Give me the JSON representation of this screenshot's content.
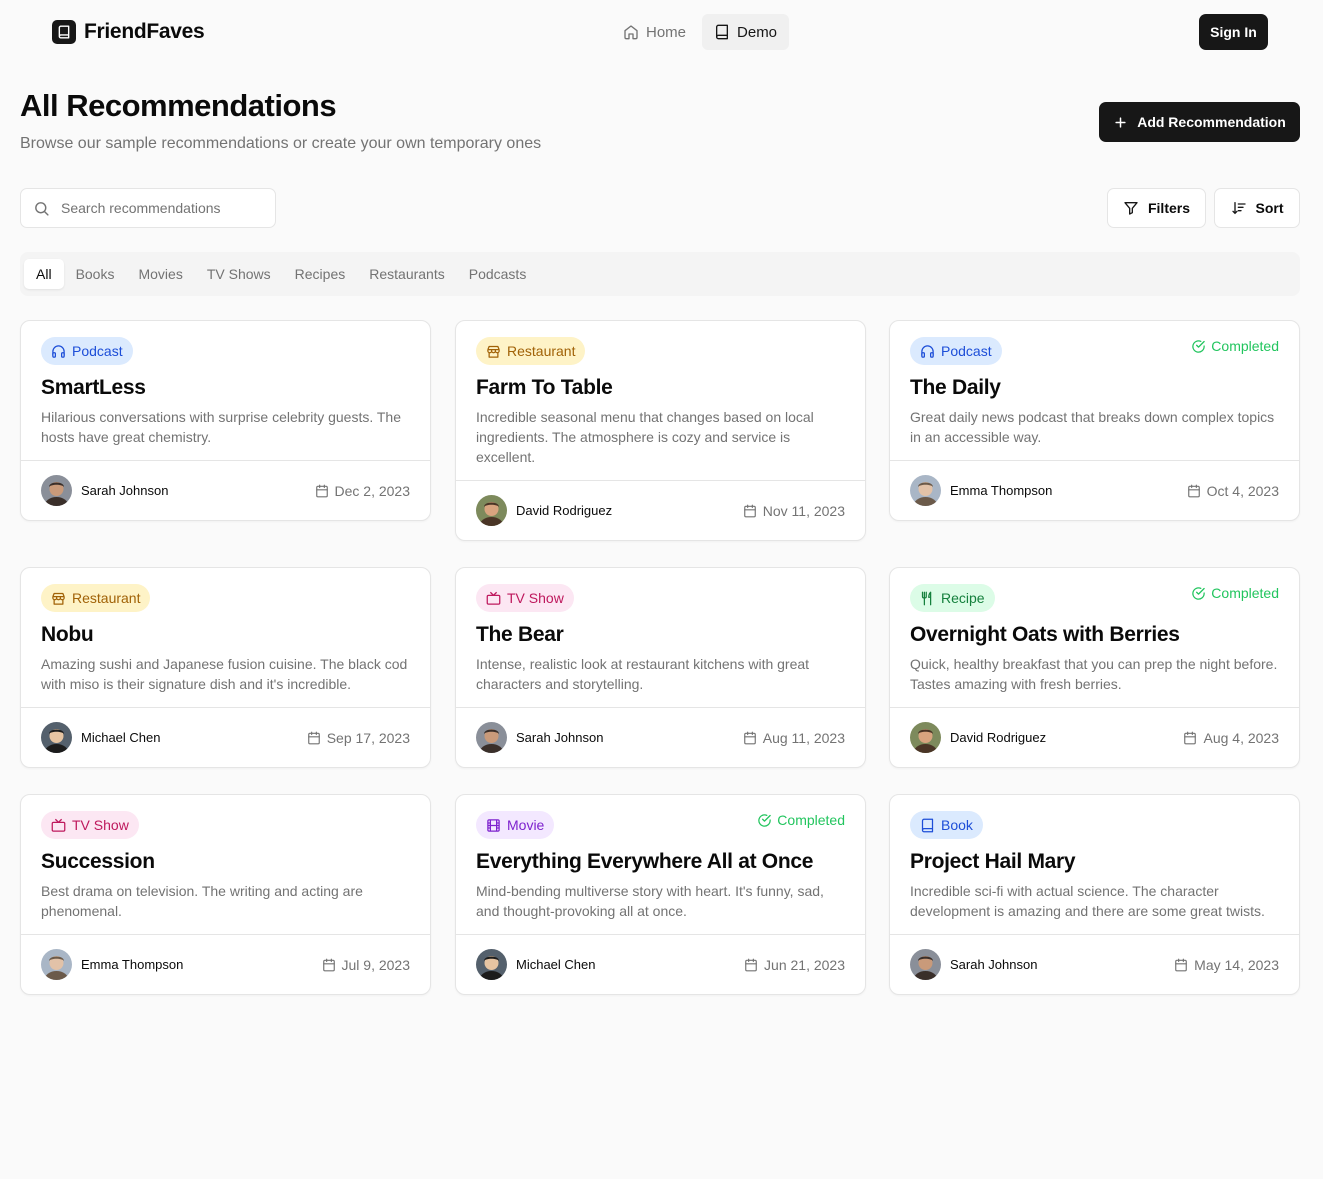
{
  "header": {
    "app_name": "FriendFaves",
    "nav": [
      {
        "label": "Home",
        "icon": "home-icon"
      },
      {
        "label": "Demo",
        "icon": "book-icon",
        "active": true
      }
    ],
    "sign_in_label": "Sign In"
  },
  "page": {
    "title": "All Recommendations",
    "subtitle": "Browse our sample recommendations or create your own temporary ones",
    "add_button_label": "Add Recommendation",
    "search_placeholder": "Search recommendations",
    "filters_label": "Filters",
    "sort_label": "Sort"
  },
  "tabs": [
    "All",
    "Books",
    "Movies",
    "TV Shows",
    "Recipes",
    "Restaurants",
    "Podcasts"
  ],
  "active_tab": "All",
  "colors": {
    "podcast_bg": "#dbeafe",
    "podcast_fg": "#1d4ed8",
    "restaurant_bg": "#fef3c7",
    "restaurant_fg": "#a16207",
    "tvshow_bg": "#fce7f3",
    "tvshow_fg": "#be185d",
    "recipe_bg": "#dcfce7",
    "recipe_fg": "#15803d",
    "movie_bg": "#f3e8ff",
    "movie_fg": "#7e22ce",
    "book_bg": "#dbeafe",
    "book_fg": "#1d4ed8",
    "completed": "#22c55e"
  },
  "completed_label": "Completed",
  "cards": [
    {
      "category": "Podcast",
      "title": "SmartLess",
      "description": "Hilarious conversations with surprise celebrity guests. The hosts have great chemistry.",
      "user": "Sarah Johnson",
      "date": "Dec 2, 2023",
      "completed": false
    },
    {
      "category": "Restaurant",
      "title": "Farm To Table",
      "description": "Incredible seasonal menu that changes based on local ingredients. The atmosphere is cozy and service is excellent.",
      "user": "David Rodriguez",
      "date": "Nov 11, 2023",
      "completed": false
    },
    {
      "category": "Podcast",
      "title": "The Daily",
      "description": "Great daily news podcast that breaks down complex topics in an accessible way.",
      "user": "Emma Thompson",
      "date": "Oct 4, 2023",
      "completed": true
    },
    {
      "category": "Restaurant",
      "title": "Nobu",
      "description": "Amazing sushi and Japanese fusion cuisine. The black cod with miso is their signature dish and it's incredible.",
      "user": "Michael Chen",
      "date": "Sep 17, 2023",
      "completed": false
    },
    {
      "category": "TV Show",
      "title": "The Bear",
      "description": "Intense, realistic look at restaurant kitchens with great characters and storytelling.",
      "user": "Sarah Johnson",
      "date": "Aug 11, 2023",
      "completed": false
    },
    {
      "category": "Recipe",
      "title": "Overnight Oats with Berries",
      "description": "Quick, healthy breakfast that you can prep the night before. Tastes amazing with fresh berries.",
      "user": "David Rodriguez",
      "date": "Aug 4, 2023",
      "completed": true
    },
    {
      "category": "TV Show",
      "title": "Succession",
      "description": "Best drama on television. The writing and acting are phenomenal.",
      "user": "Emma Thompson",
      "date": "Jul 9, 2023",
      "completed": false
    },
    {
      "category": "Movie",
      "title": "Everything Everywhere All at Once",
      "description": "Mind-bending multiverse story with heart. It's funny, sad, and thought-provoking all at once.",
      "user": "Michael Chen",
      "date": "Jun 21, 2023",
      "completed": true
    },
    {
      "category": "Book",
      "title": "Project Hail Mary",
      "description": "Incredible sci-fi with actual science. The character development is amazing and there are some great twists.",
      "user": "Sarah Johnson",
      "date": "May 14, 2023",
      "completed": false
    }
  ]
}
